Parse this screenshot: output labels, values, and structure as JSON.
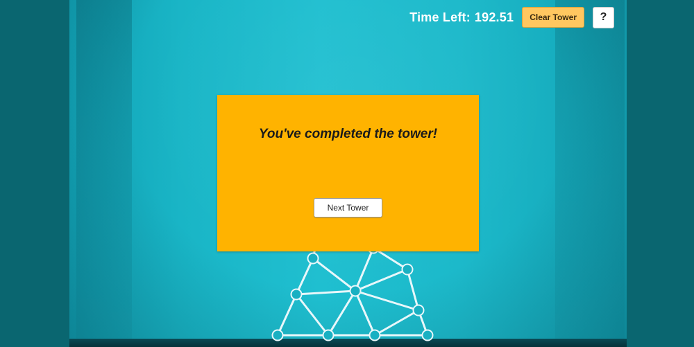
{
  "hud": {
    "time_label": "Time Left:",
    "time_value": "192.51",
    "clear_label": "Clear Tower",
    "help_label": "?"
  },
  "dialog": {
    "message": "You've completed the tower!",
    "next_label": "Next Tower"
  },
  "colors": {
    "background": "#1cb9ca",
    "dialog": "#ffb300",
    "clear_button": "#ffc760",
    "tower": "#e8f7fa"
  },
  "tower": {
    "node_count": 11,
    "edge_count": 20
  }
}
